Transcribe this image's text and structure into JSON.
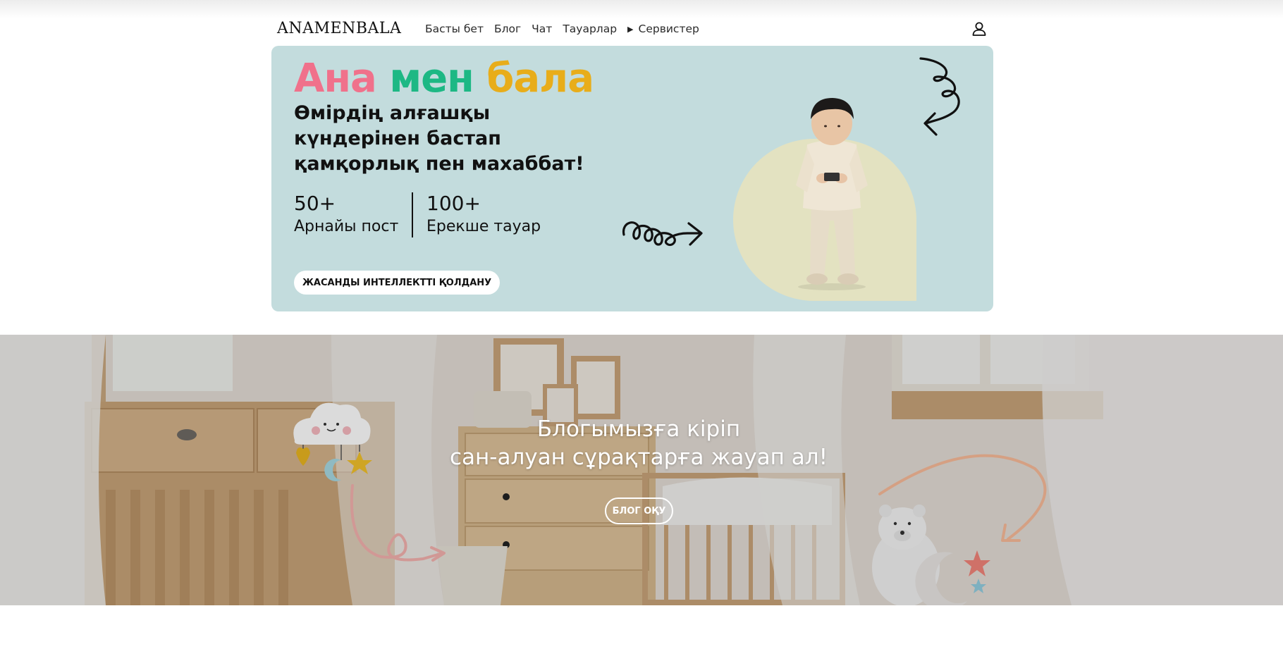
{
  "header": {
    "logo": "ANAMENBALA",
    "nav": [
      "Басты бет",
      "Блог",
      "Чат",
      "Тауарлар"
    ],
    "services_label": "Сервистер"
  },
  "hero": {
    "title_words": [
      "Ана",
      "мен",
      "бала"
    ],
    "subtitle": "Өмірдің алғашқы күндерінен бастап қамқорлық пен махаббат!",
    "stats": [
      {
        "value": "50+",
        "label": "Арнайы пост"
      },
      {
        "value": "100+",
        "label": "Ерекше тауар"
      }
    ],
    "cta_label": "ЖАСАНДЫ ИНТЕЛЛЕКТТІ ҚОЛДАНУ",
    "colors": {
      "background": "#c3dcdd",
      "word1": "#f0718b",
      "word2": "#1db884",
      "word3": "#e8ad1a"
    }
  },
  "blog_banner": {
    "line1": "Блогымызға кіріп",
    "line2": "сан-алуан сұрақтарға жауап ал!",
    "button_label": "БЛОГ ОҚУ"
  },
  "icons": {
    "user": "user-icon",
    "services_toggle": "triangle-right-icon"
  }
}
